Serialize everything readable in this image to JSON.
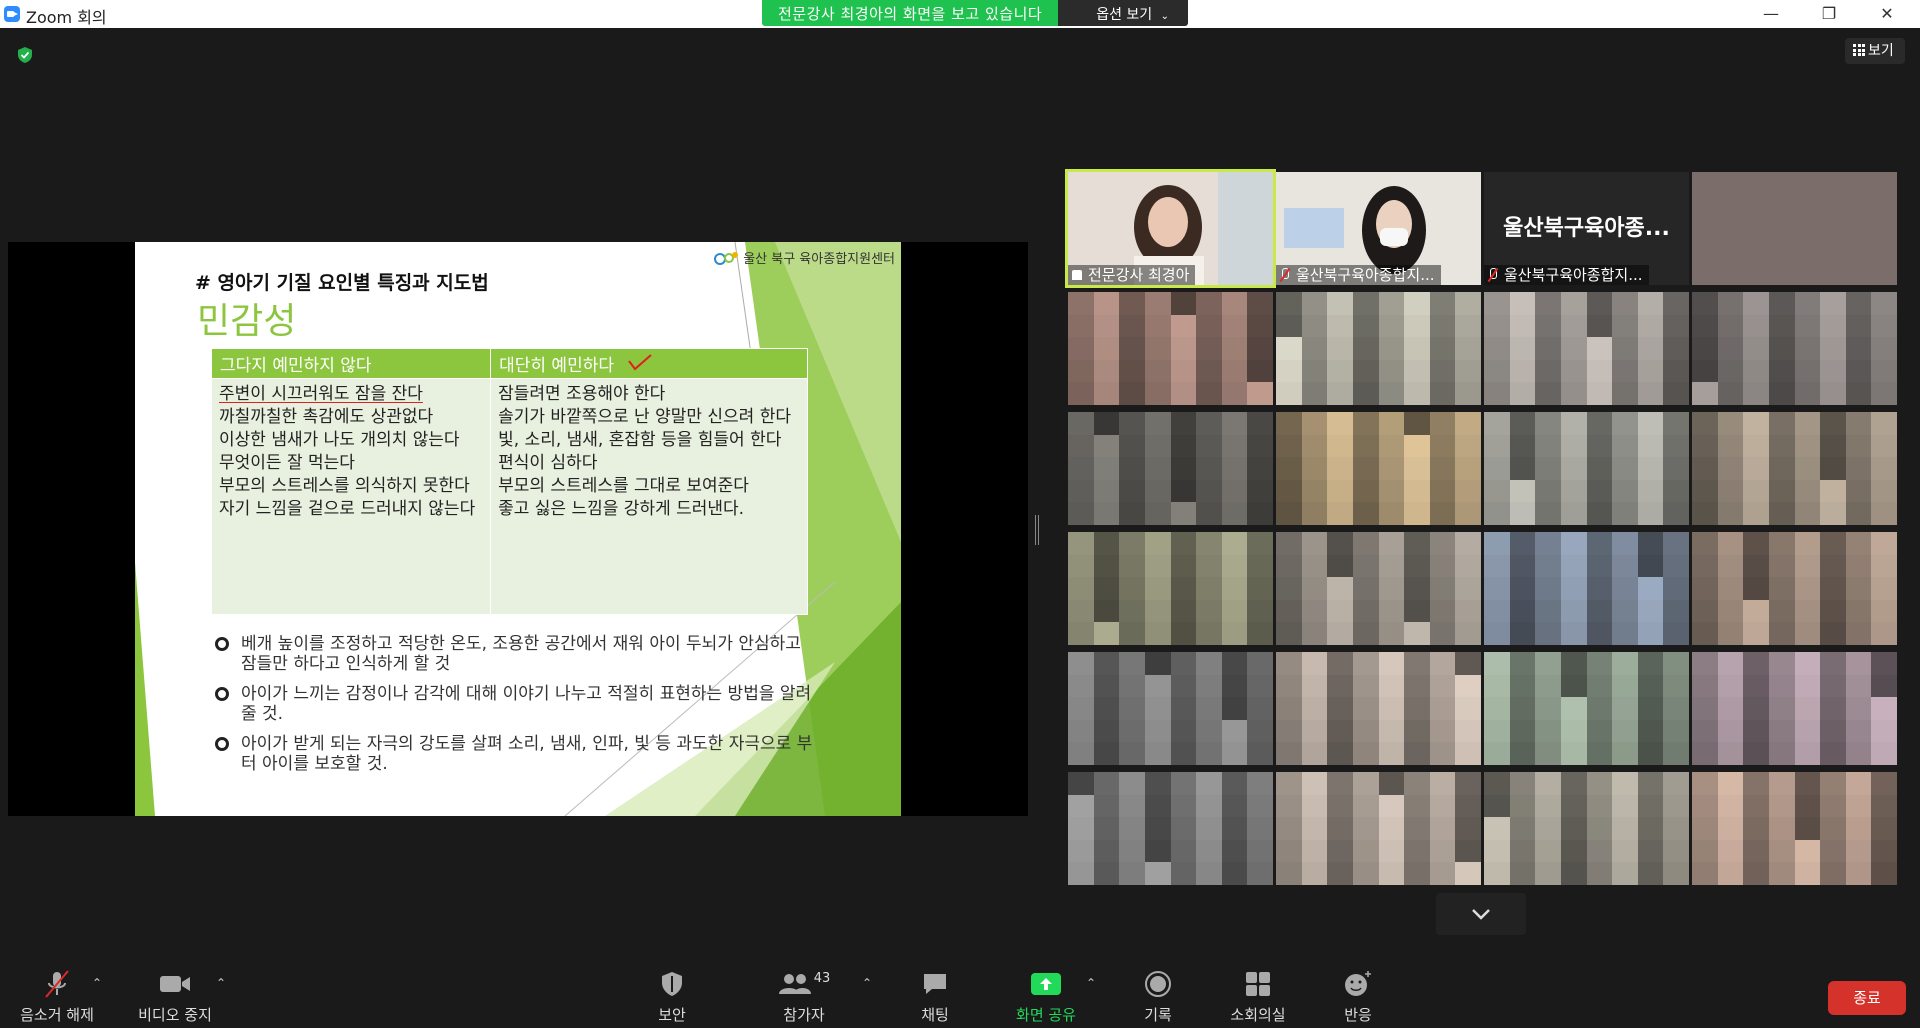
{
  "window": {
    "title": "Zoom 회의"
  },
  "share_banner": {
    "message": "전문강사 최경아의 화면을 보고 있습니다",
    "options_label": "옵션 보기"
  },
  "window_controls": {
    "minimize": "—",
    "restore": "❐",
    "close": "✕"
  },
  "view_button": {
    "label": "보기"
  },
  "slide": {
    "logo_text": "울산 북구 육아종합지원센터",
    "heading": "# 영아기 기질 요인별 특징과 지도법",
    "topic": "민감성",
    "table": {
      "headers": [
        "그다지  예민하지 않다",
        "대단히 예민하다"
      ],
      "col1": [
        "주변이 시끄러워도 잠을 잔다",
        "까칠까칠한 촉감에도 상관없다",
        "이상한 냄새가 나도 개의치 않는다",
        "무엇이든 잘 먹는다",
        "부모의 스트레스를 의식하지 못한다",
        "자기 느낌을 겉으로 드러내지 않는다"
      ],
      "col2": [
        "잠들려면 조용해야 한다",
        "솔기가 바깥쪽으로 난 양말만 신으려 한다",
        "빛, 소리, 냄새, 혼잡함 등을 힘들어 한다",
        "편식이 심하다",
        "부모의 스트레스를 그대로 보여준다",
        "좋고 싫은 느낌을 강하게 드러낸다."
      ]
    },
    "bullets": [
      "베개 높이를 조정하고 적당한 온도, 조용한 공간에서 재워 아이 두뇌가 안심하고 잠들만 하다고 인식하게 할  것",
      "아이가 느끼는 감정이나 감각에 대해 이야기 나누고 적절히 표현하는 방법을 알려 줄 것.",
      "아이가 받게 되는 자극의 강도를 살펴 소리, 냄새, 인파, 빛 등 과도한 자극으로 부터 아이를 보호할 것."
    ]
  },
  "participants": {
    "named": [
      {
        "name": "전문강사 최경아",
        "active": true,
        "pinned": true
      },
      {
        "name": "울산북구육아종합지...",
        "muted": true
      },
      {
        "name": "울산북구육아종합지...",
        "muted": true,
        "center_label": "울산북구육아종..."
      }
    ],
    "tile_colors": [
      "#8a6f66",
      "#9c9a8f",
      "#8f8a86",
      "#777270",
      "#5e5c58",
      "#9e8b6c",
      "#8c8c86",
      "#8a7f72",
      "#7a7a66",
      "#88827a",
      "#6f7a8a",
      "#8b7a6e",
      "#6b6b6b",
      "#a0958c",
      "#7d8a7c",
      "#8e7e86",
      "#747474",
      "#998f86",
      "#8e8a80",
      "#9a8478",
      "#7c766f"
    ]
  },
  "toolbar": {
    "unmute": "음소거 해제",
    "stop_video": "비디오 중지",
    "security": "보안",
    "participants": "참가자",
    "participant_count": "43",
    "chat": "채팅",
    "share_screen": "화면 공유",
    "record": "기록",
    "breakout": "소회의실",
    "reactions": "반응",
    "end": "종료"
  },
  "colors": {
    "accent_green": "#8cc63f",
    "share_green": "#1fc24f",
    "active_outline": "#c9e84a",
    "end_red": "#d6322c"
  }
}
